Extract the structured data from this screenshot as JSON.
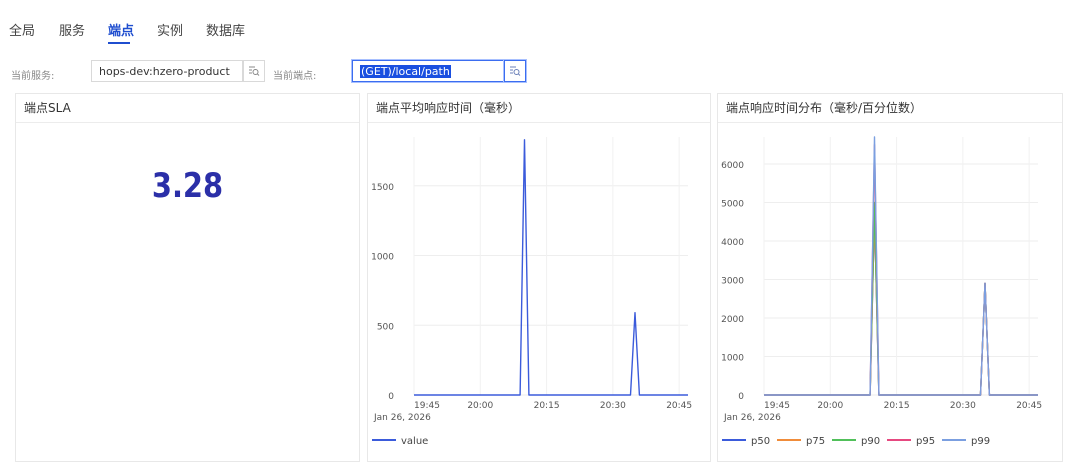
{
  "nav": {
    "tabs": [
      {
        "label": "全局"
      },
      {
        "label": "服务"
      },
      {
        "label": "端点",
        "active": true
      },
      {
        "label": "实例"
      },
      {
        "label": "数据库"
      }
    ],
    "accent": "#1f4ecf"
  },
  "filters": {
    "service_label": "当前服务:",
    "service_value": "hops-dev:hzero-product",
    "endpoint_label": "当前端点:",
    "endpoint_value": "(GET)/local/path"
  },
  "panels": {
    "sla": {
      "title": "端点SLA",
      "value": "3.28",
      "value_color": "#2b2fa8"
    },
    "avg": {
      "title": "端点平均响应时间（毫秒）"
    },
    "dist": {
      "title": "端点响应时间分布（毫秒/百分位数）"
    }
  },
  "chart_data": [
    {
      "type": "line",
      "title": "端点平均响应时间（毫秒）",
      "x": [
        "19:45",
        "19:50",
        "19:55",
        "20:00",
        "20:05",
        "20:09",
        "20:10",
        "20:11",
        "20:15",
        "20:20",
        "20:25",
        "20:30",
        "20:34",
        "20:35",
        "20:36",
        "20:40",
        "20:45",
        "20:47"
      ],
      "x_ticks": [
        "19:45",
        "20:00",
        "20:15",
        "20:30",
        "20:45"
      ],
      "x_date_label": "Jan 26, 2026",
      "ylim": [
        0,
        1850
      ],
      "y_ticks": [
        0,
        500,
        1000,
        1500
      ],
      "grid": true,
      "legend": "bottom-left",
      "series": [
        {
          "name": "value",
          "color": "#3b5bdb",
          "values": [
            0,
            0,
            0,
            0,
            0,
            0,
            1830,
            0,
            0,
            0,
            0,
            0,
            0,
            590,
            0,
            0,
            0,
            0
          ]
        }
      ]
    },
    {
      "type": "line",
      "title": "端点响应时间分布（毫秒/百分位数）",
      "x": [
        "19:45",
        "19:50",
        "19:55",
        "20:00",
        "20:05",
        "20:09",
        "20:10",
        "20:11",
        "20:15",
        "20:20",
        "20:25",
        "20:30",
        "20:34",
        "20:35",
        "20:36",
        "20:40",
        "20:45",
        "20:47"
      ],
      "x_ticks": [
        "19:45",
        "20:00",
        "20:15",
        "20:30",
        "20:45"
      ],
      "x_date_label": "Jan 26, 2026",
      "ylim": [
        0,
        6700
      ],
      "y_ticks": [
        0,
        1000,
        2000,
        3000,
        4000,
        5000,
        6000
      ],
      "grid": true,
      "legend": "bottom-left",
      "series": [
        {
          "name": "p50",
          "color": "#3b5bdb",
          "values": [
            0,
            0,
            0,
            0,
            0,
            0,
            4700,
            0,
            0,
            0,
            0,
            0,
            0,
            2900,
            0,
            0,
            0,
            0
          ]
        },
        {
          "name": "p75",
          "color": "#f08c3a",
          "values": [
            0,
            0,
            0,
            0,
            0,
            0,
            4700,
            0,
            0,
            0,
            0,
            0,
            0,
            2900,
            0,
            0,
            0,
            0
          ]
        },
        {
          "name": "p90",
          "color": "#51c05a",
          "values": [
            0,
            0,
            0,
            0,
            0,
            0,
            5000,
            0,
            0,
            0,
            0,
            0,
            0,
            2900,
            0,
            0,
            0,
            0
          ]
        },
        {
          "name": "p95",
          "color": "#e64980",
          "values": [
            0,
            0,
            0,
            0,
            0,
            0,
            6500,
            0,
            0,
            0,
            0,
            0,
            0,
            2900,
            0,
            0,
            0,
            0
          ]
        },
        {
          "name": "p99",
          "color": "#7b9fe0",
          "values": [
            0,
            0,
            0,
            0,
            0,
            0,
            6700,
            0,
            0,
            0,
            0,
            0,
            0,
            2900,
            0,
            0,
            0,
            0
          ]
        }
      ]
    }
  ]
}
